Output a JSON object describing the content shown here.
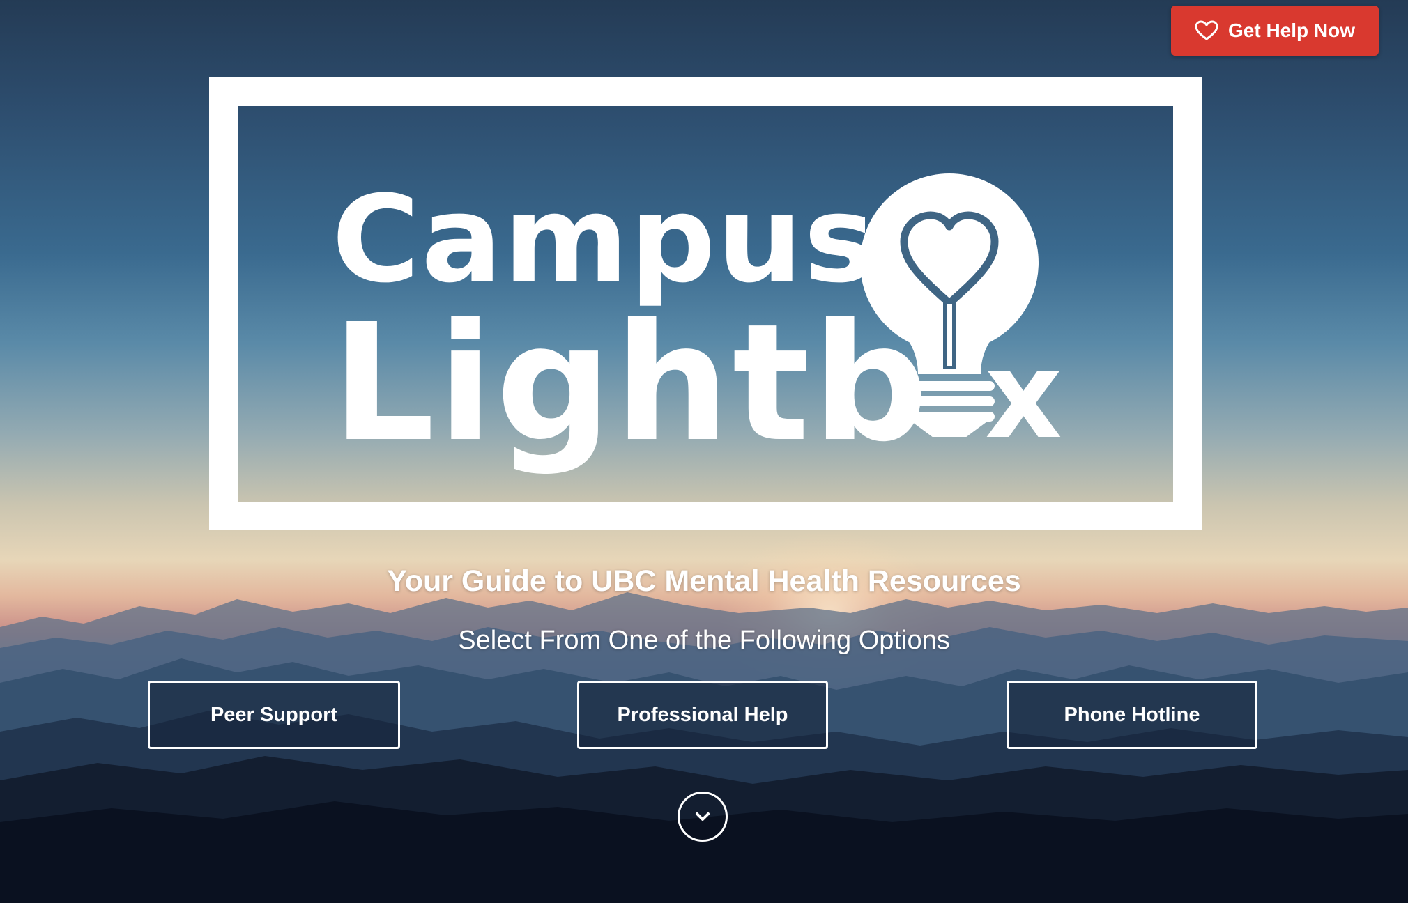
{
  "header": {
    "help_button_label": "Get Help Now",
    "help_icon": "heart-outline-icon",
    "accent_color": "#d9392f"
  },
  "logo": {
    "word_1": "Campus",
    "word_2_part_1": "Lightb",
    "word_2_part_2": "x",
    "bulb_icon": "lightbulb-heart-icon"
  },
  "hero": {
    "tagline": "Your Guide to UBC Mental Health Resources",
    "subtitle": "Select From One of the Following Options"
  },
  "options": [
    {
      "label": "Peer Support"
    },
    {
      "label": "Professional Help"
    },
    {
      "label": "Phone Hotline"
    }
  ],
  "scroll_icon": "chevron-down-icon"
}
